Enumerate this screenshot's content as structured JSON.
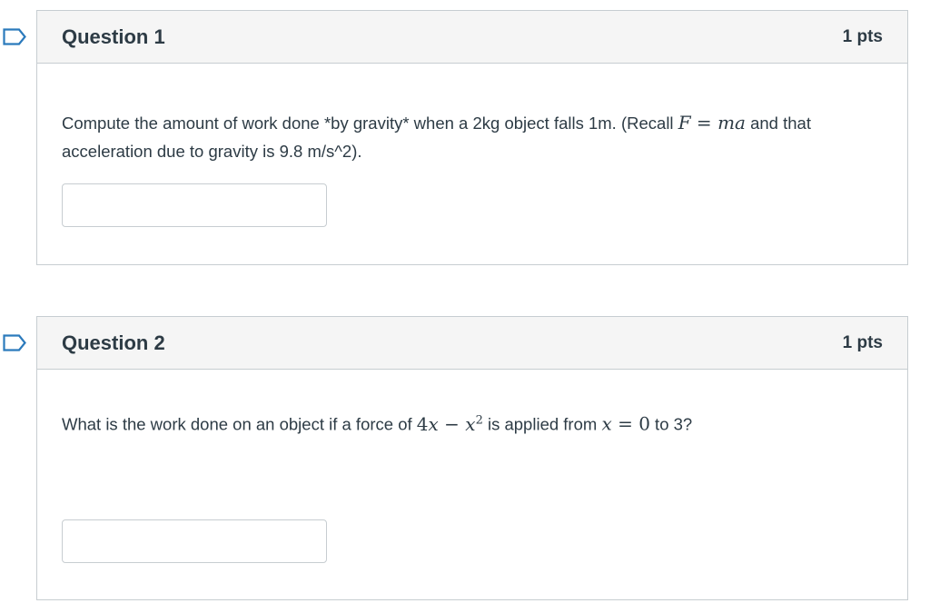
{
  "questions": [
    {
      "title": "Question 1",
      "points": "1 pts",
      "text_part1": "Compute the amount of work done *by gravity* when a 2kg object falls 1m.  (Recall ",
      "math_1": "F = ma",
      "text_part2": " and that acceleration due to gravity is 9.8 m/s^2).",
      "answer_value": ""
    },
    {
      "title": "Question 2",
      "points": "1 pts",
      "text_part1": "What is the work done on an object if a force of ",
      "math_1": "4x − x²",
      "text_part2": " is applied from ",
      "math_2": "x = 0",
      "text_part3": " to 3?",
      "answer_value": ""
    }
  ],
  "colors": {
    "flag_outline": "#2b7abc",
    "header_bg": "#f5f5f5",
    "border": "#c7cdd1",
    "text": "#2d3b45"
  },
  "icons": {
    "flag": "flag-question-icon"
  }
}
